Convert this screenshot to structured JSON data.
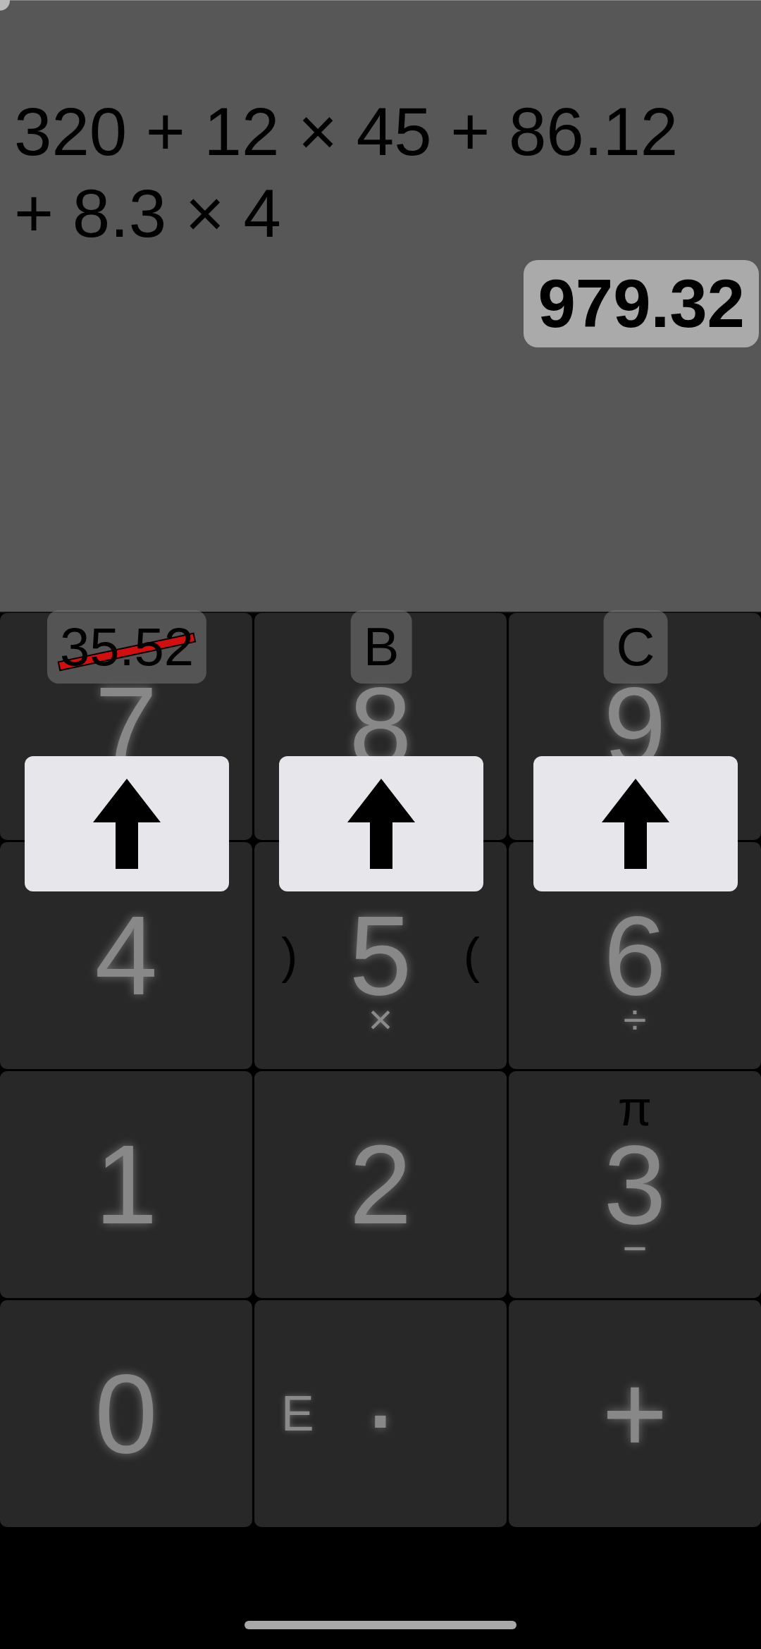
{
  "display": {
    "expression": "320 + 12 × 45 + 86.12 + 8.3 × 4",
    "result": "979.32"
  },
  "memory": [
    {
      "label": "35.52",
      "struck": true
    },
    {
      "label": "B",
      "struck": false
    },
    {
      "label": "C",
      "struck": false
    }
  ],
  "store_buttons": [
    {
      "kind": "up"
    },
    {
      "kind": "up"
    },
    {
      "kind": "up"
    }
  ],
  "keys": [
    {
      "main": "7"
    },
    {
      "main": "8"
    },
    {
      "main": "9"
    },
    {
      "main": "4"
    },
    {
      "main": "5",
      "left": {
        "text": ")",
        "dark": true
      },
      "right": {
        "text": "(",
        "dark": true
      },
      "below": {
        "text": "×",
        "dark": false
      }
    },
    {
      "main": "6",
      "below": {
        "text": "÷",
        "dark": false
      }
    },
    {
      "main": "1"
    },
    {
      "main": "2"
    },
    {
      "main": "3",
      "above": {
        "text": "π",
        "dark": true
      },
      "below": {
        "text": "−",
        "dark": false
      }
    },
    {
      "main": "0"
    },
    {
      "main": "·",
      "left": {
        "text": "E",
        "dark": false
      }
    },
    {
      "main": "+"
    }
  ]
}
